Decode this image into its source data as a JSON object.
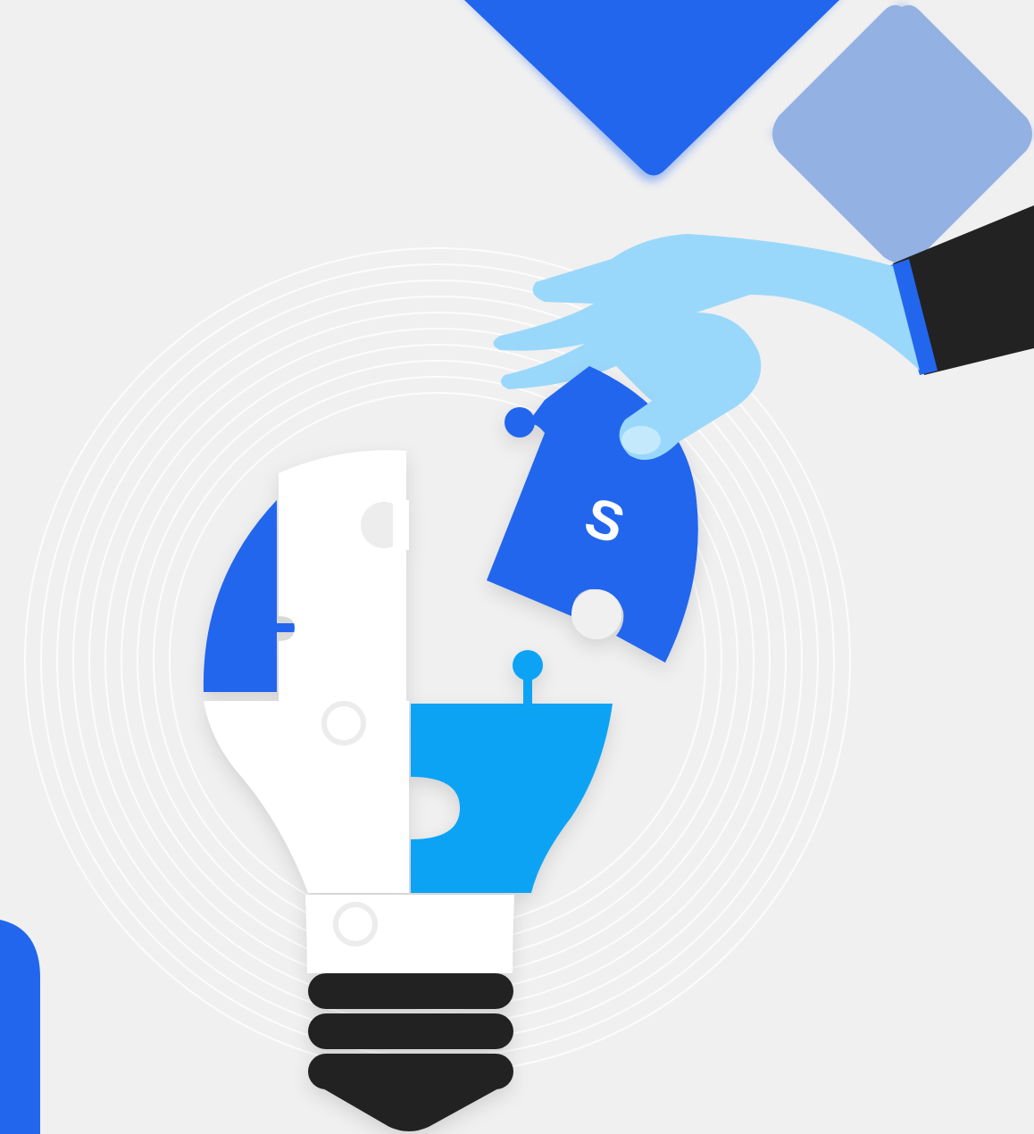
{
  "illustration": {
    "coin_symbol": "S",
    "colors": {
      "background": "#f0f0f0",
      "primary_blue": "#2266ee",
      "light_blue_diamond": "#93b1e2",
      "sky_blue_piece": "#0aa3f5",
      "hand_skin": "#9ad8fb",
      "sleeve": "#222222",
      "cuff": "#2266ee",
      "bulb_white": "#ffffff",
      "bulb_base": "#222222"
    },
    "icons": [
      "lightbulb-icon",
      "puzzle-piece-icon",
      "hand-icon",
      "dollar-sign-icon",
      "diamond-shape-icon"
    ]
  }
}
